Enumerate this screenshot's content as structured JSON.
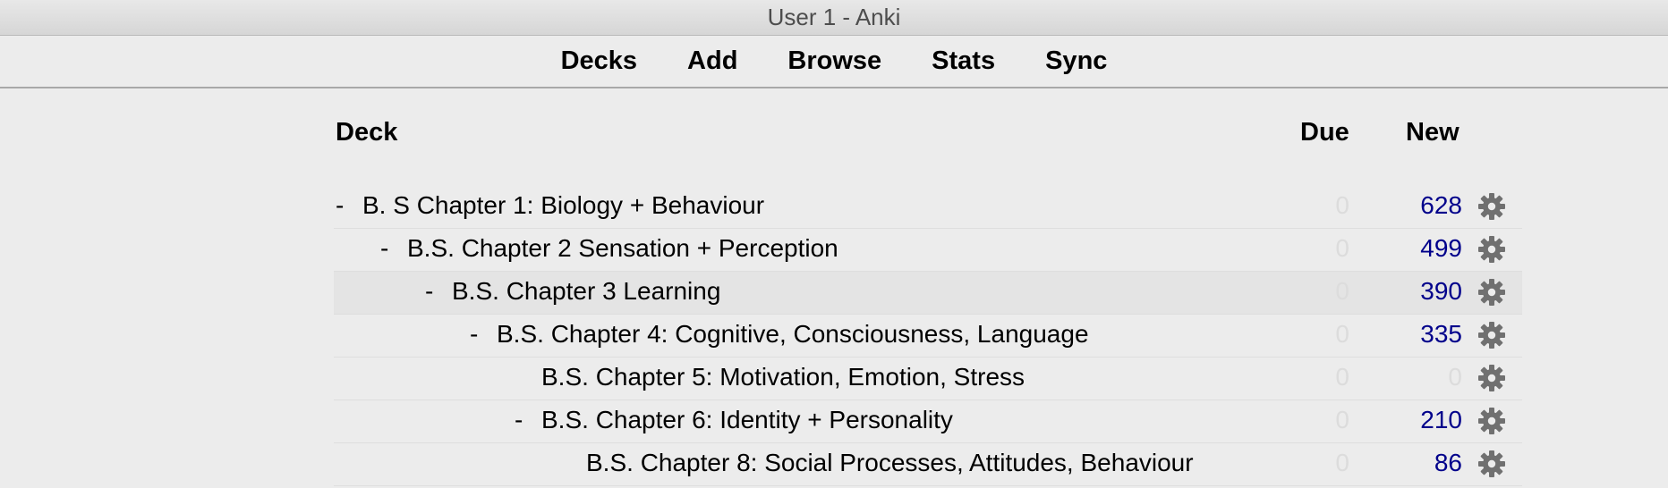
{
  "window": {
    "title": "User 1 - Anki"
  },
  "toolbar": {
    "items": [
      "Decks",
      "Add",
      "Browse",
      "Stats",
      "Sync"
    ]
  },
  "table": {
    "headers": {
      "deck": "Deck",
      "due": "Due",
      "new": "New"
    },
    "rows": [
      {
        "collapse": "-",
        "name": "B. S Chapter 1: Biology + Behaviour",
        "due": "0",
        "new": "628",
        "depth": 0
      },
      {
        "collapse": "-",
        "name": "B.S. Chapter 2 Sensation + Perception",
        "due": "0",
        "new": "499",
        "depth": 1
      },
      {
        "collapse": "-",
        "name": "B.S. Chapter 3 Learning",
        "due": "0",
        "new": "390",
        "depth": 2,
        "current": true
      },
      {
        "collapse": "-",
        "name": "B.S. Chapter 4: Cognitive, Consciousness, Language",
        "due": "0",
        "new": "335",
        "depth": 3
      },
      {
        "collapse": "",
        "name": "B.S. Chapter 5: Motivation, Emotion, Stress",
        "due": "0",
        "new": "0",
        "depth": 4
      },
      {
        "collapse": "-",
        "name": "B.S. Chapter 6: Identity + Personality",
        "due": "0",
        "new": "210",
        "depth": 4
      },
      {
        "collapse": "",
        "name": "B.S. Chapter 8: Social Processes, Attitudes, Behaviour",
        "due": "0",
        "new": "86",
        "depth": 5
      }
    ]
  },
  "icons": {
    "row_options": "gear-icon"
  },
  "colors": {
    "new_count": "#00008b",
    "zero_count": "#dcdcdc",
    "gear": "#707070"
  }
}
